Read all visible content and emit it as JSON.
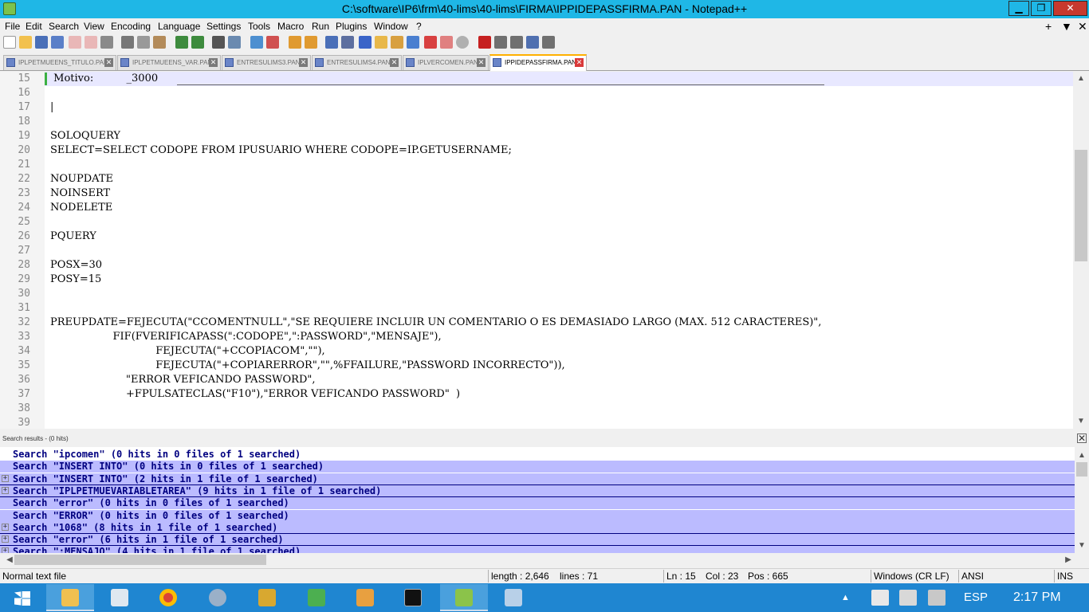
{
  "window": {
    "title": "C:\\software\\IP6\\frm\\40-lims\\40-lims\\FIRMA\\IPPIDEPASSFIRMA.PAN - Notepad++",
    "min_glyph": "▁",
    "max_glyph": "❐",
    "close_glyph": "✕"
  },
  "menu": {
    "items": [
      "File",
      "Edit",
      "Search",
      "View",
      "Encoding",
      "Language",
      "Settings",
      "Tools",
      "Macro",
      "Run",
      "Plugins",
      "Window",
      "?"
    ],
    "right": [
      "+",
      "▼",
      "✕"
    ]
  },
  "tabs": [
    {
      "label": "IPLPETMUEENS_TITULO.PAN",
      "active": false
    },
    {
      "label": "IPLPETMUEENS_VAR.PAN",
      "active": false
    },
    {
      "label": "ENTRESULIMS3.PAN",
      "active": false
    },
    {
      "label": "ENTRESULIMS4.PAN",
      "active": false
    },
    {
      "label": "IPLVERCOMEN.PAN",
      "active": false
    },
    {
      "label": "IPPIDEPASSFIRMA.PAN",
      "active": true
    }
  ],
  "editor": {
    "lines": [
      {
        "n": "15",
        "text": " Motivo:          _3000"
      },
      {
        "n": "16",
        "text": ""
      },
      {
        "n": "17",
        "text": "|"
      },
      {
        "n": "18",
        "text": ""
      },
      {
        "n": "19",
        "text": "SOLOQUERY"
      },
      {
        "n": "20",
        "text": "SELECT=SELECT CODOPE FROM IPUSUARIO WHERE CODOPE=IP.GETUSERNAME;"
      },
      {
        "n": "21",
        "text": ""
      },
      {
        "n": "22",
        "text": "NOUPDATE"
      },
      {
        "n": "23",
        "text": "NOINSERT"
      },
      {
        "n": "24",
        "text": "NODELETE"
      },
      {
        "n": "25",
        "text": ""
      },
      {
        "n": "26",
        "text": "PQUERY"
      },
      {
        "n": "27",
        "text": ""
      },
      {
        "n": "28",
        "text": "POSX=30"
      },
      {
        "n": "29",
        "text": "POSY=15"
      },
      {
        "n": "30",
        "text": ""
      },
      {
        "n": "31",
        "text": ""
      },
      {
        "n": "32",
        "text": "PREUPDATE=FEJECUTA(\"CCOMENTNULL\",\"SE REQUIERE INCLUIR UN COMENTARIO O ES DEMASIADO LARGO (MAX. 512 CARACTERES)\","
      },
      {
        "n": "33",
        "text": "                   FIF(FVERIFICAPASS(\":CODOPE\",\":PASSWORD\",\"MENSAJE\"),"
      },
      {
        "n": "34",
        "text": "                                FEJECUTA(\"+CCOPIACOM\",\"\"),"
      },
      {
        "n": "35",
        "text": "                                FEJECUTA(\"+COPIARERROR\",\"\",%FFAILURE,\"PASSWORD INCORRECTO\")),"
      },
      {
        "n": "36",
        "text": "                       \"ERROR VEFICANDO PASSWORD\","
      },
      {
        "n": "37",
        "text": "                       +FPULSATECLAS(\"F10\"),\"ERROR VEFICANDO PASSWORD\"  )"
      },
      {
        "n": "38",
        "text": ""
      },
      {
        "n": "39",
        "text": ""
      }
    ]
  },
  "search": {
    "header": "Search results - (0 hits)",
    "close": "✕",
    "rows": [
      {
        "text": "Search \"ipcomen\" (0 hits in 0 files of 1 searched)",
        "hl": false,
        "plus": false
      },
      {
        "text": "Search \"INSERT INTO\" (0 hits in 0 files of 1 searched)",
        "hl": true,
        "plus": false
      },
      {
        "text": "Search \"INSERT INTO\" (2 hits in 1 file of 1 searched)",
        "hl": true,
        "plus": true
      },
      {
        "text": "Search \"IPLPETMUEVARIABLETAREA\" (9 hits in 1 file of 1 searched)",
        "hl": true,
        "plus": true
      },
      {
        "text": "Search \"error\" (0 hits in 0 files of 1 searched)",
        "hl": true,
        "plus": false
      },
      {
        "text": "Search \"ERROR\" (0 hits in 0 files of 1 searched)",
        "hl": true,
        "plus": false
      },
      {
        "text": "Search \"1068\" (8 hits in 1 file of 1 searched)",
        "hl": true,
        "plus": true
      },
      {
        "text": "Search \"error\" (6 hits in 1 file of 1 searched)",
        "hl": true,
        "plus": true
      },
      {
        "text": "Search \":MENSAJO\" (4 hits in 1 file of 1 searched)",
        "hl": true,
        "plus": true
      }
    ]
  },
  "status": {
    "type": "Normal text file",
    "length": "length : 2,646",
    "lines": "lines : 71",
    "ln": "Ln : 15",
    "col": "Col : 23",
    "pos": "Pos : 665",
    "eol": "Windows (CR LF)",
    "enc": "ANSI",
    "mode": "INS"
  },
  "taskbar": {
    "lang": "ESP",
    "clock": "2:17 PM"
  },
  "colors": {
    "titlebar": "#1fb7e6",
    "taskbar": "#1f86d1",
    "search_highlight": "#bbbbff",
    "search_text": "#000080"
  }
}
